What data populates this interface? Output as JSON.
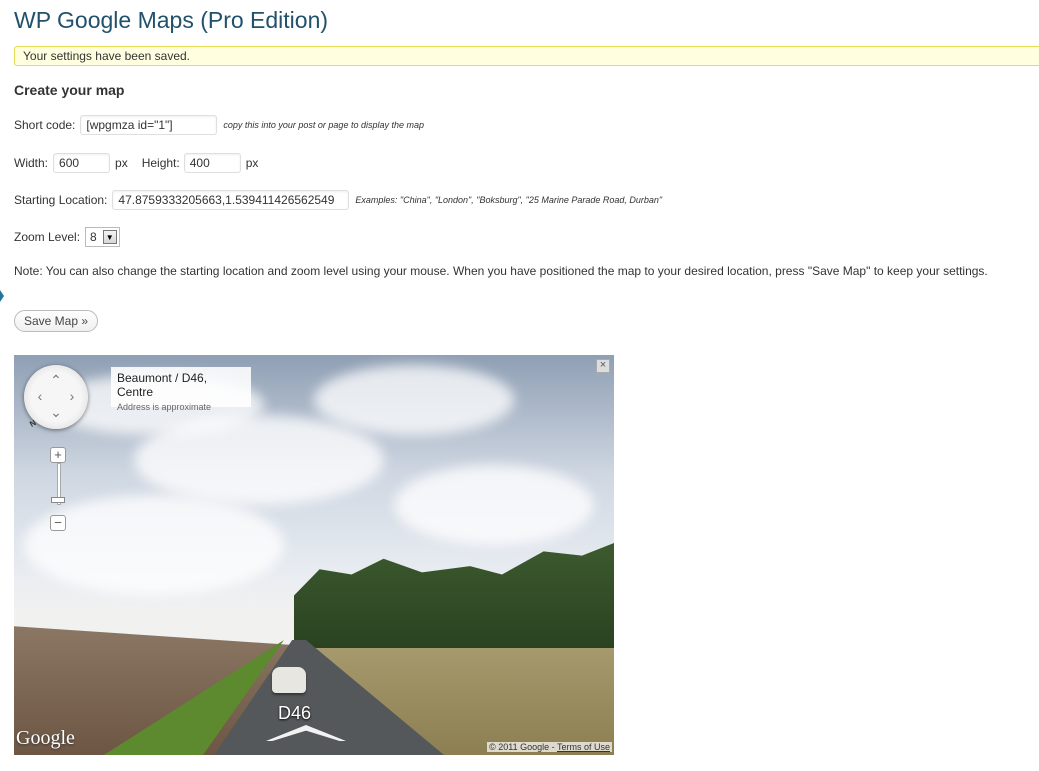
{
  "page": {
    "title": "WP Google Maps (Pro Edition)"
  },
  "notice": {
    "text": "Your settings have been saved."
  },
  "section": {
    "title": "Create your map"
  },
  "shortcode": {
    "label": "Short code:",
    "value": "[wpgmza id=\"1\"]",
    "hint": "copy this into your post or page to display the map"
  },
  "dimensions": {
    "width_label": "Width:",
    "width_value": "600",
    "width_unit": "px",
    "height_label": "Height:",
    "height_value": "400",
    "height_unit": "px"
  },
  "location": {
    "label": "Starting Location:",
    "value": "47.8759333205663,1.539411426562549",
    "hint": "Examples: \"China\", \"London\", \"Boksburg\", \"25 Marine Parade Road, Durban\""
  },
  "zoom": {
    "label": "Zoom Level:",
    "value": "8"
  },
  "note": {
    "text": "Note: You can also change the starting location and zoom level using your mouse. When you have positioned the map to your desired location, press \"Save Map\" to keep your settings."
  },
  "save": {
    "label": "Save Map »"
  },
  "map": {
    "address": "Beaumont / D46, Centre",
    "address_sub": "Address is approximate",
    "road_label": "D46",
    "compass": "N",
    "logo": "Google",
    "copyright": "© 2011 Google -",
    "terms": "Terms of Use",
    "close": "×",
    "zoom_in": "+",
    "zoom_out": "−",
    "icons": [
      "pan-control-icon",
      "zoom-in-icon",
      "zoom-out-icon",
      "close-icon",
      "road-arrow-icon"
    ]
  }
}
